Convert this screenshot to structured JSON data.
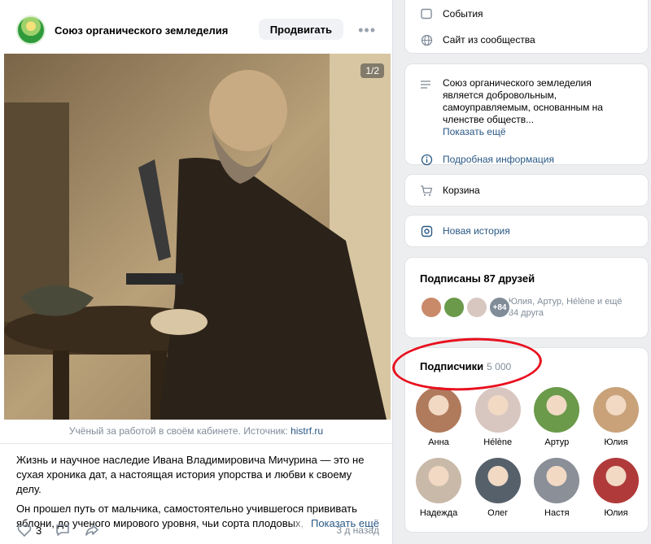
{
  "post": {
    "group_name": "Союз органического земледелия",
    "promote_label": "Продвигать",
    "photo_counter": "1/2",
    "caption_text": "Учёный за работой в своём кабинете. Источник: ",
    "caption_link": "histrf.ru",
    "paragraph1": "Жизнь и научное наследие Ивана Владимировича Мичурина — это не сухая хроника дат, а настоящая история упорства и любви к своему делу.",
    "paragraph2": "Он прошел путь от мальчика, самостоятельно учившегося прививать яблони, до ученого мирового уровня, чьи сорта плодовых, ягод",
    "show_more": "Показать ещё",
    "likes_count": "3",
    "time": "3 д назад"
  },
  "sidebar": {
    "events_label": "События",
    "site_label": "Сайт из сообщества",
    "about_text": "Союз органического земледелия является добровольным, самоуправляемым, основанным на членстве обществ...",
    "about_more": "Показать ещё",
    "details_label": "Подробная информация",
    "cart_label": "Корзина",
    "story_label": "Новая история",
    "friends_title": "Подписаны 87 друзей",
    "friends_extra": "+84",
    "friends_text": "Юлия, Артур, Hélène и ещё 84 друга",
    "subs_title": "Подписчики",
    "subs_count": "5 000",
    "subscribers": [
      {
        "name": "Анна",
        "color": "#b07a5c"
      },
      {
        "name": "Hélène",
        "color": "#d8c7c0"
      },
      {
        "name": "Артур",
        "color": "#6a9a4a"
      },
      {
        "name": "Юлия",
        "color": "#c9a27a"
      },
      {
        "name": "Надежда",
        "color": "#c9b9a8"
      },
      {
        "name": "Олег",
        "color": "#55606a"
      },
      {
        "name": "Настя",
        "color": "#8a8f98"
      },
      {
        "name": "Юлия",
        "color": "#b03a3a"
      }
    ]
  }
}
